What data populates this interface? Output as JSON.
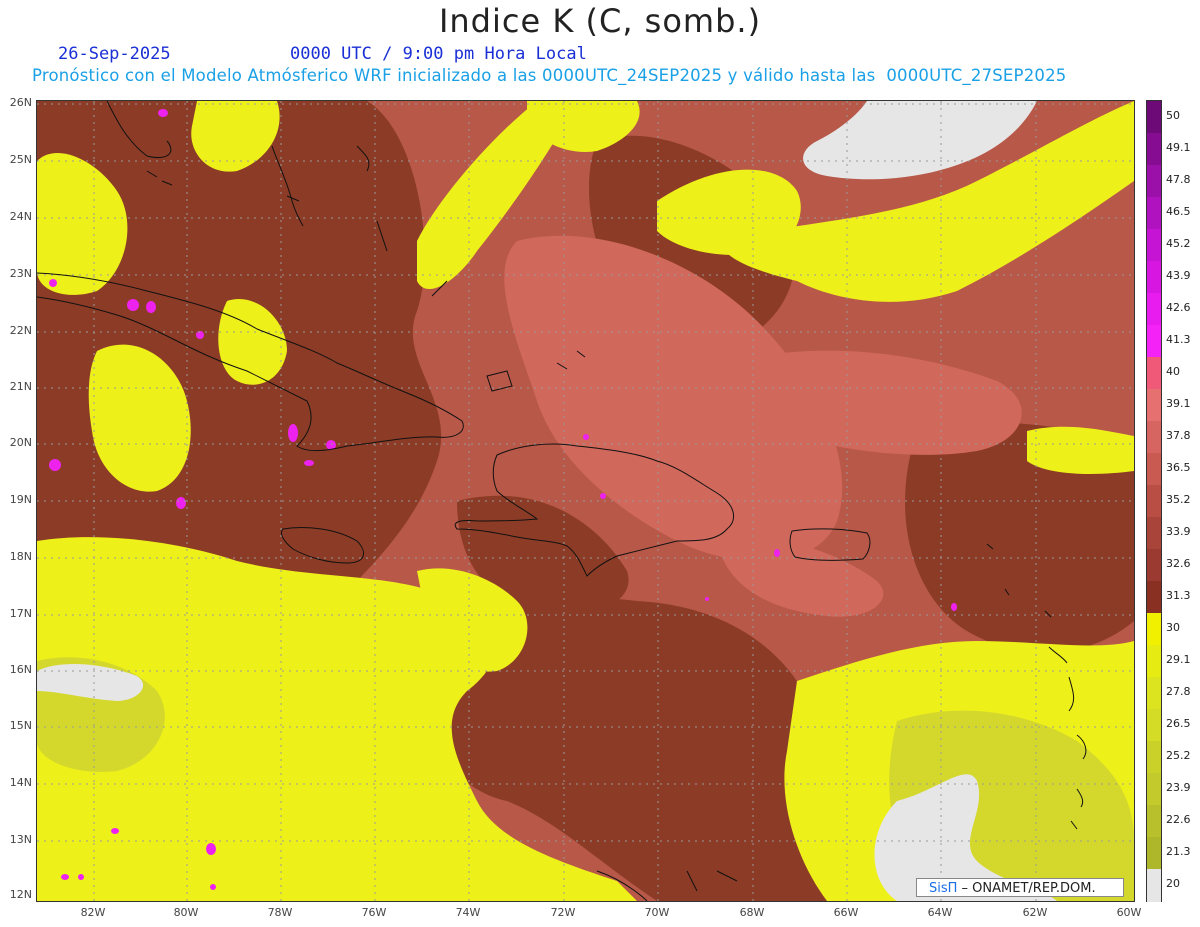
{
  "title": "Indice K (C, somb.)",
  "date": "26-Sep-2025",
  "time": "0000 UTC / 9:00 pm Hora Local",
  "subtitle": "Pronóstico con el Modelo Atmósferico WRF inicializado a las 0000UTC_24SEP2025 y válido hasta las  0000UTC_27SEP2025",
  "credit": {
    "brand": "SisΠ",
    "rest": " – ONAMET/REP.DOM."
  },
  "lat_labels": [
    "26N",
    "25N",
    "24N",
    "23N",
    "22N",
    "21N",
    "20N",
    "19N",
    "18N",
    "17N",
    "16N",
    "15N",
    "14N",
    "13N",
    "12N"
  ],
  "lon_labels": [
    "82W",
    "80W",
    "78W",
    "76W",
    "74W",
    "72W",
    "70W",
    "68W",
    "66W",
    "64W",
    "62W",
    "60W"
  ],
  "colorbar": {
    "labels": [
      "50",
      "49.1",
      "47.8",
      "46.5",
      "45.2",
      "43.9",
      "42.6",
      "41.3",
      "40",
      "39.1",
      "37.8",
      "36.5",
      "35.2",
      "33.9",
      "32.6",
      "31.3",
      "30",
      "29.1",
      "27.8",
      "26.5",
      "25.2",
      "23.9",
      "22.6",
      "21.3",
      "20"
    ],
    "colors": [
      "#6e0a78",
      "#860d92",
      "#9a10a8",
      "#b012c0",
      "#c614d4",
      "#d816e2",
      "#e81cee",
      "#f422f6",
      "#f05a78",
      "#e67070",
      "#d66460",
      "#c85a52",
      "#b84e44",
      "#a8443a",
      "#9a3a30",
      "#8a3022",
      "#f0f000",
      "#e6ec12",
      "#dce420",
      "#d4dc26",
      "#cad22a",
      "#c2ca2c",
      "#b8c02c",
      "#aeb62a",
      "#e6e6e6"
    ]
  },
  "colors": {
    "dark_brown": "#8a3a25",
    "mid_red": "#b95a48",
    "light_red": "#d66e62",
    "yellow": "#eef01a",
    "olive_yellow": "#d2d62a",
    "magenta": "#ee22ee",
    "gray": "#e6e6e6"
  }
}
